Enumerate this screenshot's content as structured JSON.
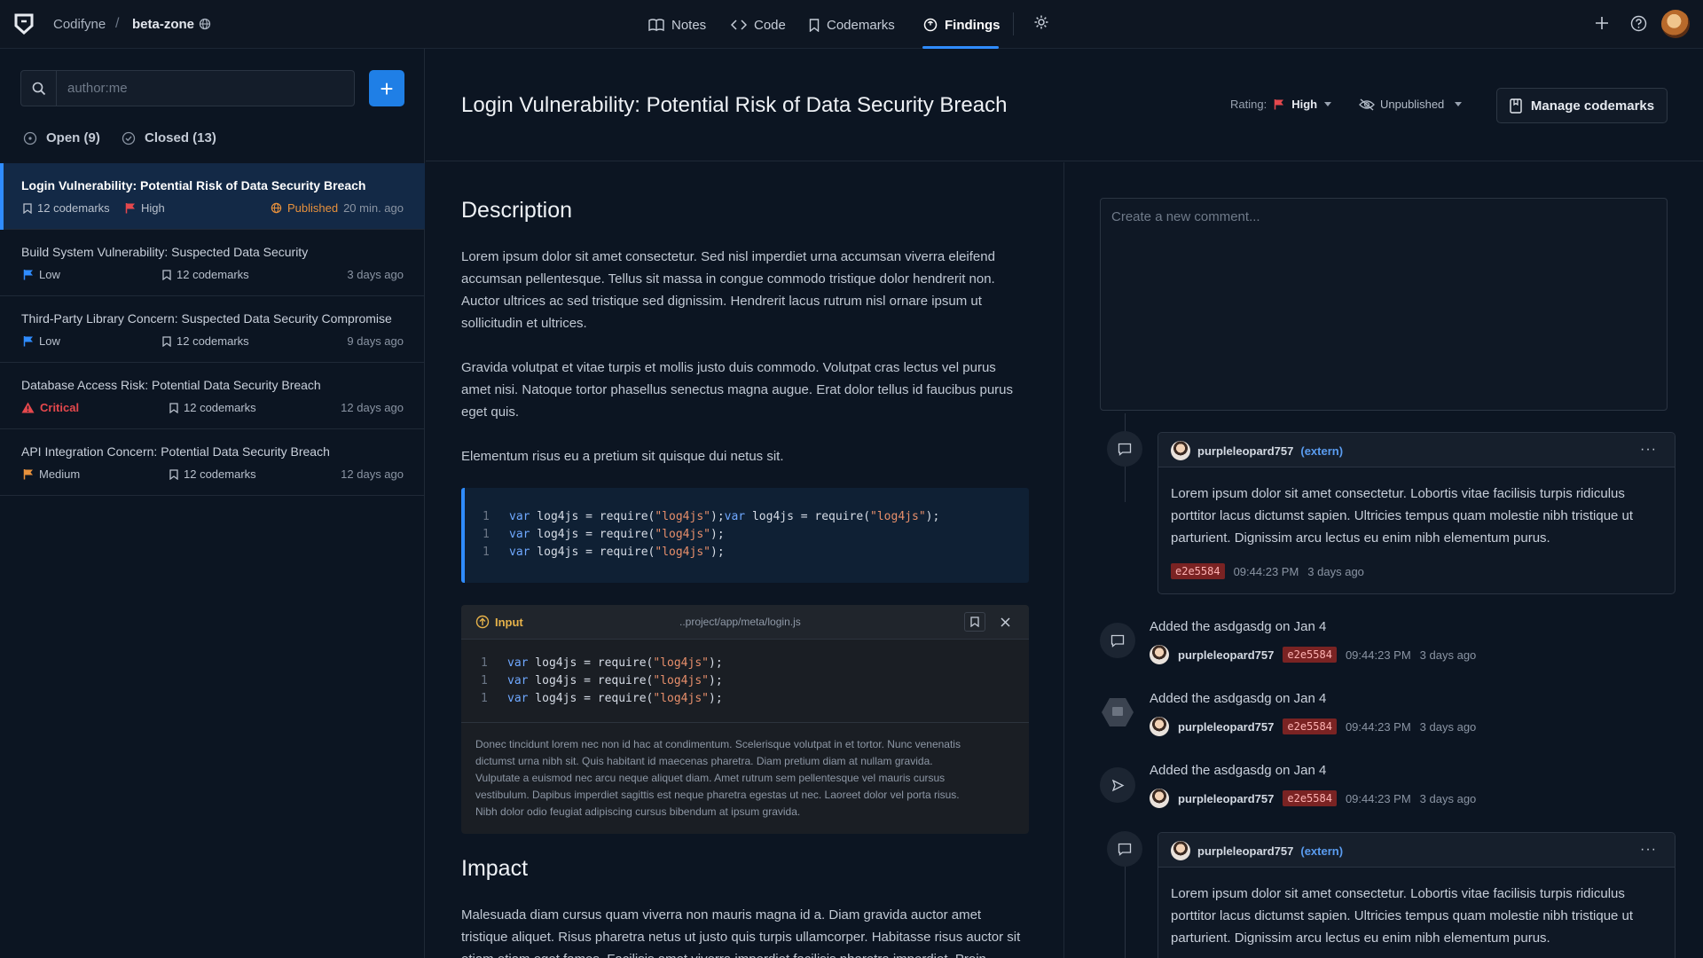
{
  "topbar": {
    "org": "Codifyne",
    "separator": "/",
    "project": "beta-zone",
    "tabs": [
      {
        "label": "Notes",
        "icon": "book-icon"
      },
      {
        "label": "Code",
        "icon": "code-icon"
      },
      {
        "label": "Codemarks",
        "icon": "bookmark-icon"
      },
      {
        "label": "Findings",
        "icon": "findings-icon",
        "active": true
      }
    ],
    "accent": "#2f8cff"
  },
  "sidebar": {
    "search_placeholder": "author:me",
    "add_label": "+",
    "filters": {
      "open": "Open (9)",
      "closed": "Closed (13)"
    },
    "items": [
      {
        "title": "Login Vulnerability: Potential Risk of Data Security Breach",
        "codemarks": "12 codemarks",
        "rating": "High",
        "rating_color": "#e5484d",
        "status": "Published",
        "age": "20 min. ago"
      },
      {
        "title": "Build System Vulnerability: Suspected Data Security",
        "rating": "Low",
        "rating_color": "#2f8cff",
        "codemarks": "12 codemarks",
        "age": "3 days ago"
      },
      {
        "title": "Third-Party Library Concern: Suspected Data Security Compromise",
        "rating": "Low",
        "rating_color": "#2f8cff",
        "codemarks": "12 codemarks",
        "age": "9 days ago"
      },
      {
        "title": "Database Access Risk: Potential Data Security Breach",
        "rating": "Critical",
        "rating_color": "#e5484d",
        "codemarks": "12 codemarks",
        "age": "12 days ago"
      },
      {
        "title": "API Integration Concern: Potential Data Security Breach",
        "rating": "Medium",
        "rating_color": "#e8913c",
        "codemarks": "12 codemarks",
        "age": "12 days ago"
      }
    ]
  },
  "header": {
    "title": "Login Vulnerability: Potential Risk of Data Security Breach",
    "rating_label": "Rating:",
    "rating_value": "High",
    "publish_state": "Unpublished",
    "manage_label": "Manage codemarks"
  },
  "content": {
    "description_heading": "Description",
    "paragraphs": [
      "Lorem ipsum dolor sit amet consectetur. Sed nisl imperdiet urna accumsan viverra eleifend accumsan pellentesque. Tellus sit massa in congue commodo tristique dolor hendrerit non. Auctor ultrices ac sed tristique sed dignissim. Hendrerit lacus rutrum nisl ornare ipsum ut sollicitudin et ultrices.",
      "Gravida volutpat et vitae turpis et mollis justo duis commodo. Volutpat cras lectus vel purus amet nisi. Natoque tortor phasellus senectus magna augue. Erat dolor tellus id faucibus purus eget quis.",
      "Elementum risus eu a pretium sit quisque dui netus sit."
    ],
    "code_block": {
      "lines": [
        {
          "num": "1",
          "kw1": "var",
          "a": " log4js = require(",
          "s1": "\"log4js\"",
          "b": ");",
          "kw2": "var",
          "c": " log4js = require(",
          "s2": "\"log4js\"",
          "d": ");"
        },
        {
          "num": "1",
          "kw1": "var",
          "a": " log4js = require(",
          "s1": "\"log4js\"",
          "b": ");"
        },
        {
          "num": "1",
          "kw1": "var",
          "a": " log4js = require(",
          "s1": "\"log4js\"",
          "b": ");"
        }
      ]
    },
    "input_panel": {
      "label": "Input",
      "path": "..project/app/meta/login.js",
      "lines": [
        {
          "num": "1",
          "kw1": "var",
          "a": " log4js = require(",
          "s1": "\"log4js\"",
          "b": ");"
        },
        {
          "num": "1",
          "kw1": "var",
          "a": " log4js = require(",
          "s1": "\"log4js\"",
          "b": ");"
        },
        {
          "num": "1",
          "kw1": "var",
          "a": " log4js = require(",
          "s1": "\"log4js\"",
          "b": ");"
        }
      ],
      "note": "Donec tincidunt lorem nec non id hac at condimentum. Scelerisque volutpat in et tortor. Nunc venenatis dictumst urna nibh sit. Quis habitant id maecenas pharetra. Diam pretium diam at nullam gravida. Vulputate a euismod nec arcu neque aliquet diam. Amet rutrum sem pellentesque vel mauris cursus vestibulum. Dapibus imperdiet sagittis est neque pharetra egestas ut nec. Laoreet dolor vel porta risus. Nibh dolor odio feugiat adipiscing cursus bibendum at ipsum gravida."
    },
    "impact_heading": "Impact",
    "impact_paragraph": "Malesuada diam cursus quam viverra non mauris magna id a. Diam gravida auctor amet tristique aliquet. Risus pharetra netus ut justo quis turpis ullamcorper. Habitasse risus auctor sit etiam etiam eget fames. Facilisis amet viverra imperdiet facilisis pharetra imperdiet. Proin sapien lectus"
  },
  "comments": {
    "placeholder": "Create a new comment...",
    "cards": [
      {
        "user": "purpleleopard757",
        "tag": "(extern)",
        "more": "···",
        "body": "Lorem ipsum dolor sit amet consectetur. Lobortis vitae facilisis turpis ridiculus porttitor lacus dictumst sapien. Ultricies tempus quam molestie nibh tristique ut parturient. Dignissim arcu lectus eu enim nibh elementum purus.",
        "hash": "e2e5584",
        "time": "09:44:23 PM",
        "age": "3 days ago"
      },
      {
        "user": "purpleleopard757",
        "tag": "(extern)",
        "more": "···",
        "body": "Lorem ipsum dolor sit amet consectetur. Lobortis vitae facilisis turpis ridiculus porttitor lacus dictumst sapien. Ultricies tempus quam molestie nibh tristique ut parturient. Dignissim arcu lectus eu enim nibh elementum purus."
      }
    ],
    "events": [
      {
        "title": "Added the asdgasdg on Jan 4",
        "user": "purpleleopard757",
        "hash": "e2e5584",
        "time": "09:44:23 PM",
        "age": "3 days ago"
      },
      {
        "title": "Added the asdgasdg on Jan 4",
        "user": "purpleleopard757",
        "hash": "e2e5584",
        "time": "09:44:23 PM",
        "age": "3 days ago"
      },
      {
        "title": "Added the asdgasdg on Jan 4",
        "user": "purpleleopard757",
        "hash": "e2e5584",
        "time": "09:44:23 PM",
        "age": "3 days ago"
      }
    ]
  }
}
